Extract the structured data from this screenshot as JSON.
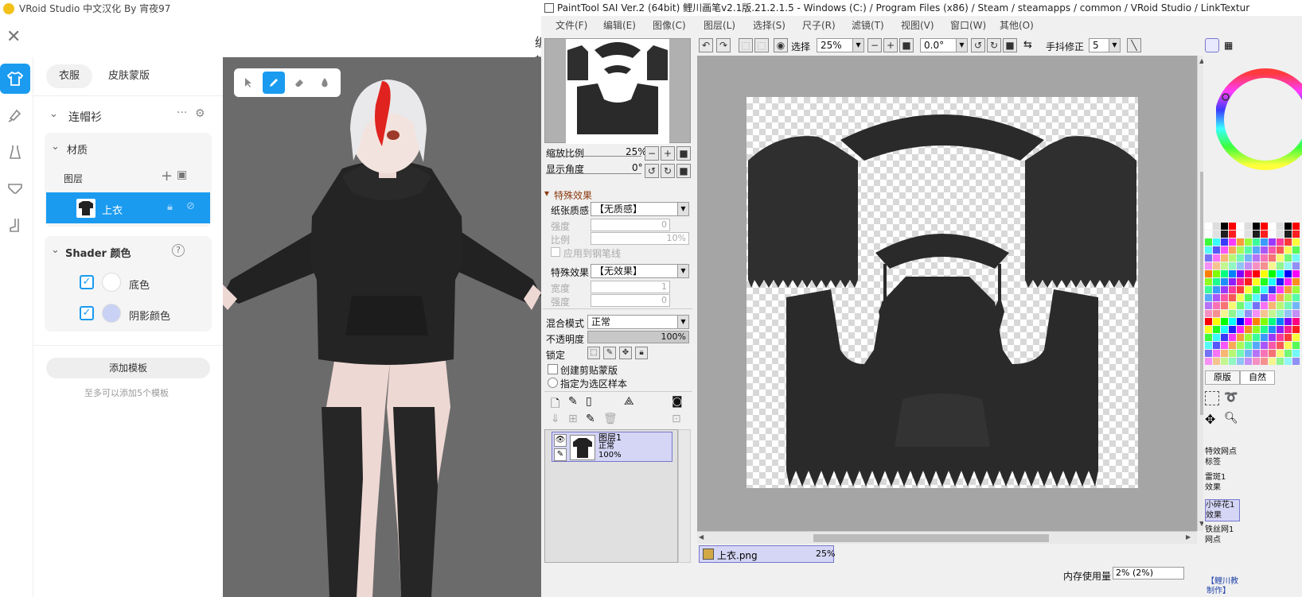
{
  "vroid": {
    "window_title": "VRoid Studio 中文汉化 By 宵夜97",
    "header": "编辑",
    "tabs": [
      "衣服",
      "皮肤蒙版"
    ],
    "rail_icons": [
      "shirt-icon",
      "brush-tag-icon",
      "dress-icon",
      "underwear-icon",
      "sock-icon"
    ],
    "item_name": "连帽衫",
    "material_label": "材质",
    "layer_label": "图层",
    "selected_layer": "上衣",
    "shader_label": "Shader 颜色",
    "base_color_label": "底色",
    "shadow_color_label": "阴影颜色",
    "add_template": "添加模板",
    "template_hint": "至多可以添加5个模板",
    "colors": {
      "accent": "#1a9bf0",
      "base": "#ffffff",
      "shadow": "#c9d2f5"
    }
  },
  "sai": {
    "window_title": "PaintTool SAI Ver.2 (64bit) 鲤川画笔v2.1版.21.2.1.5 - Windows (C:) / Program Files (x86) / Steam / steamapps / common / VRoid Studio / LinkTextur",
    "menu": [
      "文件(F)",
      "编辑(E)",
      "图像(C)",
      "图层(L)",
      "选择(S)",
      "尺子(R)",
      "滤镜(T)",
      "视图(V)",
      "窗口(W)",
      "其他(O)"
    ],
    "toolbar": {
      "select_label": "选择",
      "zoom": "25%",
      "angle": "0.0°",
      "stabilizer_label": "手抖修正",
      "stabilizer": "5"
    },
    "navigator": {
      "zoom_label": "缩放比例",
      "zoom_value": "25%",
      "angle_label": "显示角度",
      "angle_value": "0°"
    },
    "effects": {
      "header": "特殊效果",
      "paper_label": "纸张质感",
      "paper_value": "【无质感】",
      "strength_label": "强度",
      "strength_value": "0",
      "scale_label": "比例",
      "scale_value": "10%",
      "apply_pen": "应用到钢笔线",
      "effect_label": "特殊效果",
      "effect_value": "【无效果】",
      "width_label": "宽度",
      "width_value": "1",
      "strength2_label": "强度",
      "strength2_value": "0"
    },
    "layer_props": {
      "blend_label": "混合模式",
      "blend_value": "正常",
      "opacity_label": "不透明度",
      "opacity_value": "100%",
      "opacity": 1.0,
      "lock_label": "锁定",
      "clip_label": "创建剪贴蒙版",
      "sample_label": "指定为选区样本"
    },
    "layer": {
      "name": "图层1",
      "mode": "正常",
      "opacity": "100%"
    },
    "status": {
      "file_name": "上衣.png",
      "file_zoom": "25%",
      "memory_label": "内存使用量",
      "memory_value": "2% (2%)"
    },
    "right_panel": {
      "tab_a": "原版",
      "tab_b": "自然",
      "brushes": [
        {
          "l1": "特效网点",
          "l2": "标签"
        },
        {
          "l1": "雷斑1",
          "l2": "效果"
        },
        {
          "l1": "小碎花1",
          "l2": "效果"
        },
        {
          "l1": "铁丝网1",
          "l2": "网点"
        }
      ],
      "footer": "【鲤川教 制作】"
    }
  }
}
